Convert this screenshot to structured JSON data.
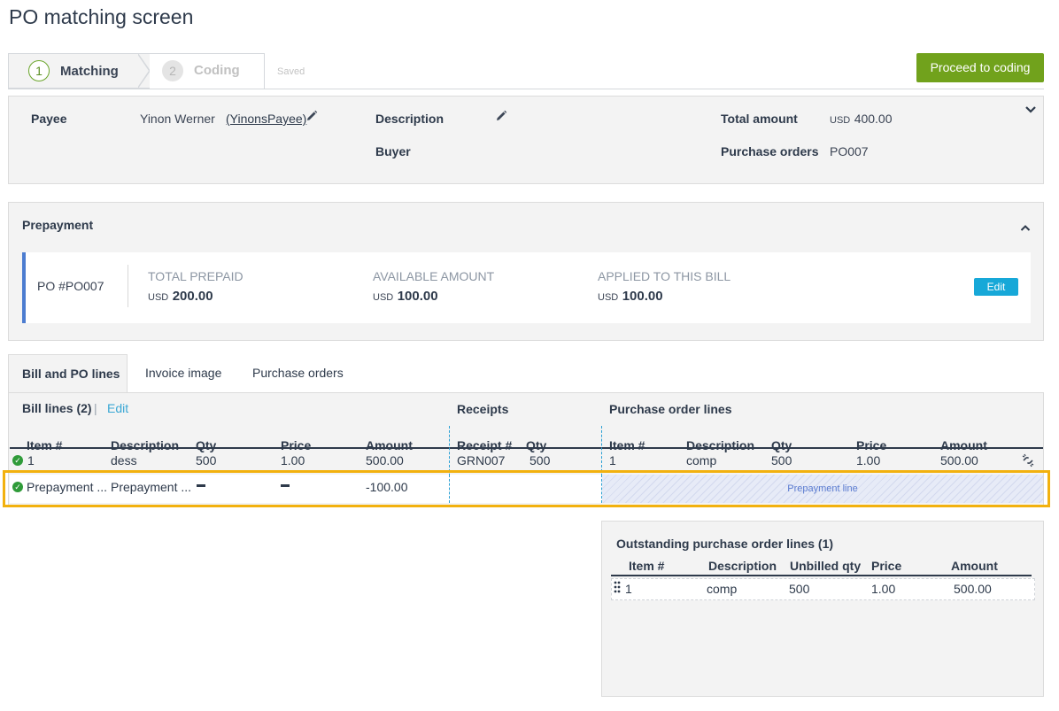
{
  "page": {
    "title": "PO matching screen"
  },
  "stepper": {
    "steps": [
      {
        "number": "1",
        "label": "Matching"
      },
      {
        "number": "2",
        "label": "Coding"
      }
    ],
    "saved": "Saved"
  },
  "actions": {
    "proceed": "Proceed to coding"
  },
  "header": {
    "payee_label": "Payee",
    "payee_name": "Yinon Werner",
    "payee_link": "(YinonsPayee)",
    "description_label": "Description",
    "buyer_label": "Buyer",
    "total_label": "Total amount",
    "total_currency": "USD",
    "total_value": "400.00",
    "po_label": "Purchase orders",
    "po_value": "PO007"
  },
  "prepayment": {
    "title": "Prepayment",
    "po": "PO #PO007",
    "total_prepaid_label": "TOTAL PREPAID",
    "total_prepaid_currency": "USD",
    "total_prepaid": "200.00",
    "available_label": "AVAILABLE AMOUNT",
    "available_currency": "USD",
    "available": "100.00",
    "applied_label": "APPLIED TO THIS BILL",
    "applied_currency": "USD",
    "applied": "100.00",
    "edit": "Edit"
  },
  "tabs": [
    "Bill and PO lines",
    "Invoice image",
    "Purchase orders"
  ],
  "lines": {
    "bill_lines_title": "Bill lines (2)",
    "separator": "|",
    "edit": "Edit",
    "receipts_title": "Receipts",
    "po_lines_title": "Purchase order lines",
    "bill_headers": [
      "Item #",
      "Description",
      "Qty",
      "Price",
      "Amount"
    ],
    "receipt_headers": [
      "Receipt #",
      "Qty"
    ],
    "po_headers": [
      "Item #",
      "Description",
      "Qty",
      "Price",
      "Amount"
    ],
    "row1": {
      "bill": [
        "1",
        "dess",
        "500",
        "1.00",
        "500.00"
      ],
      "receipt": [
        "GRN007",
        "500"
      ],
      "po": [
        "1",
        "comp",
        "500",
        "1.00",
        "500.00"
      ]
    },
    "row2": {
      "item": "Prepayment ...",
      "description": "Prepayment ...",
      "amount": "-100.00",
      "po_placeholder": "Prepayment line"
    }
  },
  "outstanding": {
    "title": "Outstanding purchase order lines (1)",
    "headers": [
      "Item #",
      "Description",
      "Unbilled qty",
      "Price",
      "Amount"
    ],
    "row": [
      "1",
      "comp",
      "500",
      "1.00",
      "500.00"
    ]
  },
  "colors": {
    "accent_green": "#71a21c",
    "edit_blue": "#17a8d8",
    "highlight": "#f2b10e"
  },
  "icons": [
    "pencil-icon",
    "chevron-down-icon",
    "chevron-up-icon",
    "check-circle-icon",
    "unlink-icon",
    "drag-handle-icon"
  ]
}
